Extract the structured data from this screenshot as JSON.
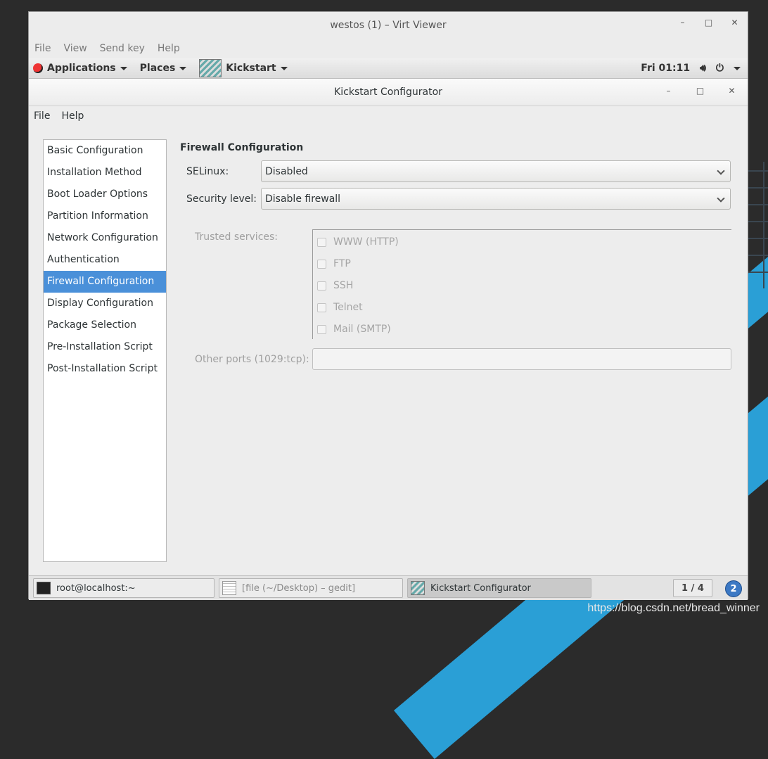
{
  "viewer": {
    "title": "westos (1) – Virt Viewer",
    "controls": {
      "minimize": "–",
      "maximize": "□",
      "close": "✕"
    },
    "menu": [
      "File",
      "View",
      "Send key",
      "Help"
    ]
  },
  "top_panel": {
    "applications": "Applications",
    "places": "Places",
    "app_name": "Kickstart",
    "clock": "Fri 01:11"
  },
  "window": {
    "title": "Kickstart Configurator",
    "menu": [
      "File",
      "Help"
    ]
  },
  "sidebar": {
    "items": [
      {
        "label": "Basic Configuration",
        "active": false
      },
      {
        "label": "Installation Method",
        "active": false
      },
      {
        "label": "Boot Loader Options",
        "active": false
      },
      {
        "label": "Partition Information",
        "active": false
      },
      {
        "label": "Network Configuration",
        "active": false
      },
      {
        "label": "Authentication",
        "active": false
      },
      {
        "label": "Firewall Configuration",
        "active": true
      },
      {
        "label": "Display Configuration",
        "active": false
      },
      {
        "label": "Package Selection",
        "active": false
      },
      {
        "label": "Pre-Installation Script",
        "active": false
      },
      {
        "label": "Post-Installation Script",
        "active": false
      }
    ]
  },
  "firewall": {
    "title": "Firewall Configuration",
    "selinux_label": "SELinux:",
    "selinux_value": "Disabled",
    "security_label": "Security level:",
    "security_value": "Disable firewall",
    "trusted_label": "Trusted services:",
    "services": [
      {
        "label": "WWW (HTTP)",
        "checked": false
      },
      {
        "label": "FTP",
        "checked": false
      },
      {
        "label": "SSH",
        "checked": false
      },
      {
        "label": "Telnet",
        "checked": false
      },
      {
        "label": "Mail (SMTP)",
        "checked": false
      }
    ],
    "ports_label": "Other ports (1029:tcp):",
    "ports_value": ""
  },
  "taskbar": {
    "tasks": [
      {
        "label": "root@localhost:~"
      },
      {
        "label": "[file (~/Desktop) – gedit]"
      },
      {
        "label": "Kickstart Configurator"
      }
    ],
    "pager": "1 / 4",
    "badge": "2"
  },
  "watermark": "https://blog.csdn.net/bread_winner",
  "colors": {
    "accent": "#4a90d9",
    "desktop_stripe": "#2a9fd6"
  }
}
